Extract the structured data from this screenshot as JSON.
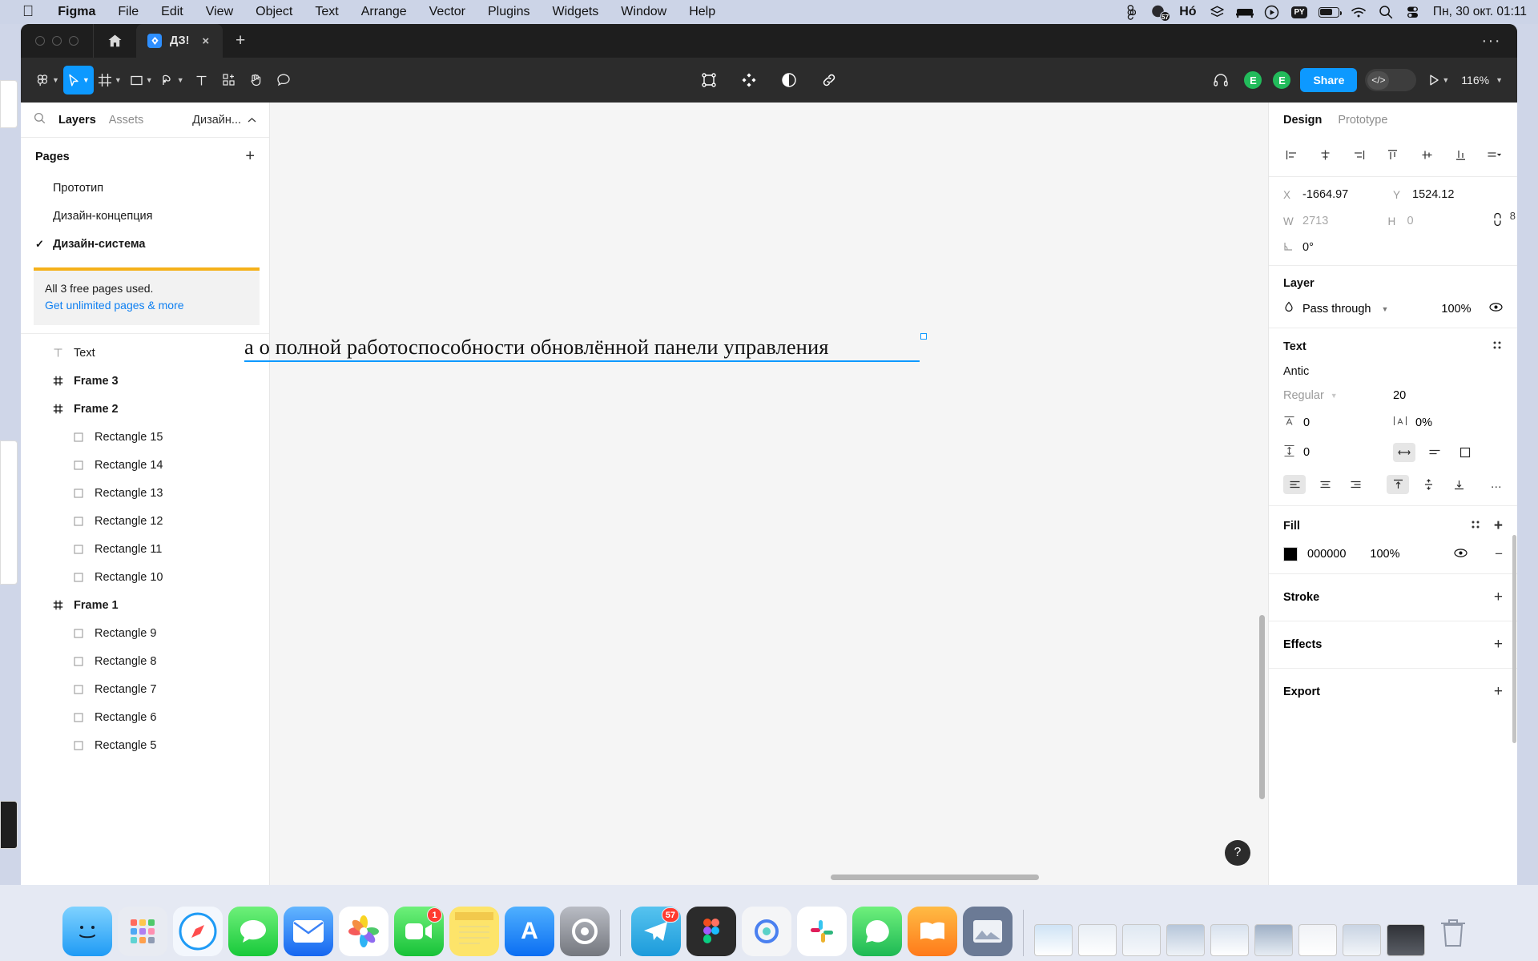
{
  "menubar": {
    "apple": "",
    "items": [
      {
        "label": "Figma",
        "bold": true
      },
      {
        "label": "File",
        "bold": false
      },
      {
        "label": "Edit",
        "bold": false
      },
      {
        "label": "View",
        "bold": false
      },
      {
        "label": "Object",
        "bold": false
      },
      {
        "label": "Text",
        "bold": false
      },
      {
        "label": "Arrange",
        "bold": false
      },
      {
        "label": "Vector",
        "bold": false
      },
      {
        "label": "Plugins",
        "bold": false
      },
      {
        "label": "Widgets",
        "bold": false
      },
      {
        "label": "Window",
        "bold": false
      },
      {
        "label": "Help",
        "bold": false
      }
    ],
    "status_icons": [
      "figma-menu-icon",
      "notification-badge-icon",
      "ho-text-icon",
      "stacks-icon",
      "bed-icon",
      "play-circle-icon",
      "py-chip-icon",
      "battery-icon",
      "wifi-icon",
      "search-icon",
      "control-center-icon"
    ],
    "notification_count": "57",
    "ho_label": "Hó",
    "py_label": "PY",
    "clock": "Пн, 30 окт.  01:11"
  },
  "window": {
    "tab_title": "ДЗ!",
    "tab_close": "×",
    "new_tab": "+",
    "more": "···"
  },
  "toolbar": {
    "left_tools": [
      {
        "name": "figma-menu-icon",
        "caret": true,
        "active": false
      },
      {
        "name": "move-tool-icon",
        "caret": true,
        "active": true
      },
      {
        "name": "frame-tool-icon",
        "caret": true,
        "active": false
      },
      {
        "name": "shape-tool-icon",
        "caret": true,
        "active": false
      },
      {
        "name": "pen-tool-icon",
        "caret": true,
        "active": false
      },
      {
        "name": "text-tool-icon",
        "caret": false,
        "active": false
      },
      {
        "name": "resources-tool-icon",
        "caret": false,
        "active": false
      },
      {
        "name": "hand-tool-icon",
        "caret": false,
        "active": false
      },
      {
        "name": "comment-tool-icon",
        "caret": false,
        "active": false
      }
    ],
    "center_tools": [
      "vector-edit-icon",
      "components-icon",
      "contrast-icon",
      "link-icon"
    ],
    "headphones_icon": "headphones-icon",
    "avatars": [
      "E",
      "E"
    ],
    "share_label": "Share",
    "devmode_icon": "</>",
    "present_icon": "play-icon",
    "zoom_level": "116%"
  },
  "left_panel": {
    "search_icon": "search-icon",
    "tabs": [
      {
        "label": "Layers",
        "selected": true
      },
      {
        "label": "Assets",
        "selected": false
      }
    ],
    "page_selector": "Дизайн...",
    "pages_title": "Pages",
    "add_page": "+",
    "pages": [
      {
        "label": "Прототип",
        "current": false
      },
      {
        "label": "Дизайн-концепция",
        "current": false
      },
      {
        "label": "Дизайн-система",
        "current": true
      }
    ],
    "upsell": {
      "text": "All 3 free pages used.",
      "link": "Get unlimited pages & more"
    },
    "layers": [
      {
        "label": "Text",
        "icon": "text-layer-icon",
        "indent": false,
        "bold": false
      },
      {
        "label": "Frame 3",
        "icon": "frame-layer-icon",
        "indent": false,
        "bold": true
      },
      {
        "label": "Frame 2",
        "icon": "frame-layer-icon",
        "indent": false,
        "bold": true
      },
      {
        "label": "Rectangle 15",
        "icon": "rectangle-layer-icon",
        "indent": true,
        "bold": false
      },
      {
        "label": "Rectangle 14",
        "icon": "rectangle-layer-icon",
        "indent": true,
        "bold": false
      },
      {
        "label": "Rectangle 13",
        "icon": "rectangle-layer-icon",
        "indent": true,
        "bold": false
      },
      {
        "label": "Rectangle 12",
        "icon": "rectangle-layer-icon",
        "indent": true,
        "bold": false
      },
      {
        "label": "Rectangle 11",
        "icon": "rectangle-layer-icon",
        "indent": true,
        "bold": false
      },
      {
        "label": "Rectangle 10",
        "icon": "rectangle-layer-icon",
        "indent": true,
        "bold": false
      },
      {
        "label": "Frame 1",
        "icon": "frame-layer-icon",
        "indent": false,
        "bold": true
      },
      {
        "label": "Rectangle 9",
        "icon": "rectangle-layer-icon",
        "indent": true,
        "bold": false
      },
      {
        "label": "Rectangle 8",
        "icon": "rectangle-layer-icon",
        "indent": true,
        "bold": false
      },
      {
        "label": "Rectangle 7",
        "icon": "rectangle-layer-icon",
        "indent": true,
        "bold": false
      },
      {
        "label": "Rectangle 6",
        "icon": "rectangle-layer-icon",
        "indent": true,
        "bold": false
      },
      {
        "label": "Rectangle 5",
        "icon": "rectangle-layer-icon",
        "indent": true,
        "bold": false
      }
    ]
  },
  "canvas": {
    "text_object": "а о полной работоспособности обновлённой панели управления",
    "help_label": "?"
  },
  "right_panel": {
    "tabs": [
      {
        "label": "Design",
        "selected": true
      },
      {
        "label": "Prototype",
        "selected": false
      }
    ],
    "edge_badge": "8",
    "position": {
      "x_label": "X",
      "x_value": "-1664.97",
      "y_label": "Y",
      "y_value": "1524.12",
      "w_label": "W",
      "w_value": "2713",
      "h_label": "H",
      "h_value": "0",
      "rotation_value": "0°"
    },
    "layer": {
      "title": "Layer",
      "blend_mode": "Pass through",
      "opacity": "100%"
    },
    "text": {
      "title": "Text",
      "font_family": "Antic",
      "font_weight": "Regular",
      "font_size": "20",
      "letter_spacing": "0",
      "paragraph_spacing": "0%",
      "line_height": "0"
    },
    "fill": {
      "title": "Fill",
      "color_hex": "000000",
      "opacity": "100%"
    },
    "stroke": {
      "title": "Stroke"
    },
    "effects": {
      "title": "Effects"
    },
    "export": {
      "title": "Export"
    }
  },
  "dock": {
    "items": [
      {
        "name": "finder",
        "color": "#1f9bf5",
        "glyph": "🙂",
        "badge": null
      },
      {
        "name": "launchpad",
        "color": "#d7dae2",
        "glyph": "",
        "badge": null
      },
      {
        "name": "safari",
        "color": "#f0f4fa",
        "glyph": "🧭",
        "badge": null
      },
      {
        "name": "messages",
        "color": "#35d74b",
        "glyph": "💬",
        "badge": null
      },
      {
        "name": "mail",
        "color": "#2a7bf6",
        "glyph": "✉",
        "badge": null
      },
      {
        "name": "photos",
        "color": "#fdfdfd",
        "glyph": "✿",
        "badge": null
      },
      {
        "name": "facetime",
        "color": "#2fcf5a",
        "glyph": "📹",
        "badge": "1"
      },
      {
        "name": "notes",
        "color": "#fde46a",
        "glyph": "",
        "badge": null
      },
      {
        "name": "app-store",
        "color": "#1d8cf5",
        "glyph": "A",
        "badge": null
      },
      {
        "name": "system-settings",
        "color": "#8e8e93",
        "glyph": "⚙",
        "badge": null
      },
      {
        "name": "telegram",
        "color": "#2aabee",
        "glyph": "✈",
        "badge": "57"
      },
      {
        "name": "figma",
        "color": "#2c2c2c",
        "glyph": "F",
        "badge": null
      },
      {
        "name": "arc",
        "color": "#f2f2f2",
        "glyph": "◯",
        "badge": null
      },
      {
        "name": "slack",
        "color": "#ffffff",
        "glyph": "✦",
        "badge": null
      },
      {
        "name": "whatsapp",
        "color": "#25d366",
        "glyph": "☎",
        "badge": null
      },
      {
        "name": "books",
        "color": "#ff9500",
        "glyph": "📖",
        "badge": null
      },
      {
        "name": "preview",
        "color": "#5a6a86",
        "glyph": "🖼",
        "badge": null
      }
    ],
    "minimized_count": 9,
    "trash": "trash-icon"
  }
}
